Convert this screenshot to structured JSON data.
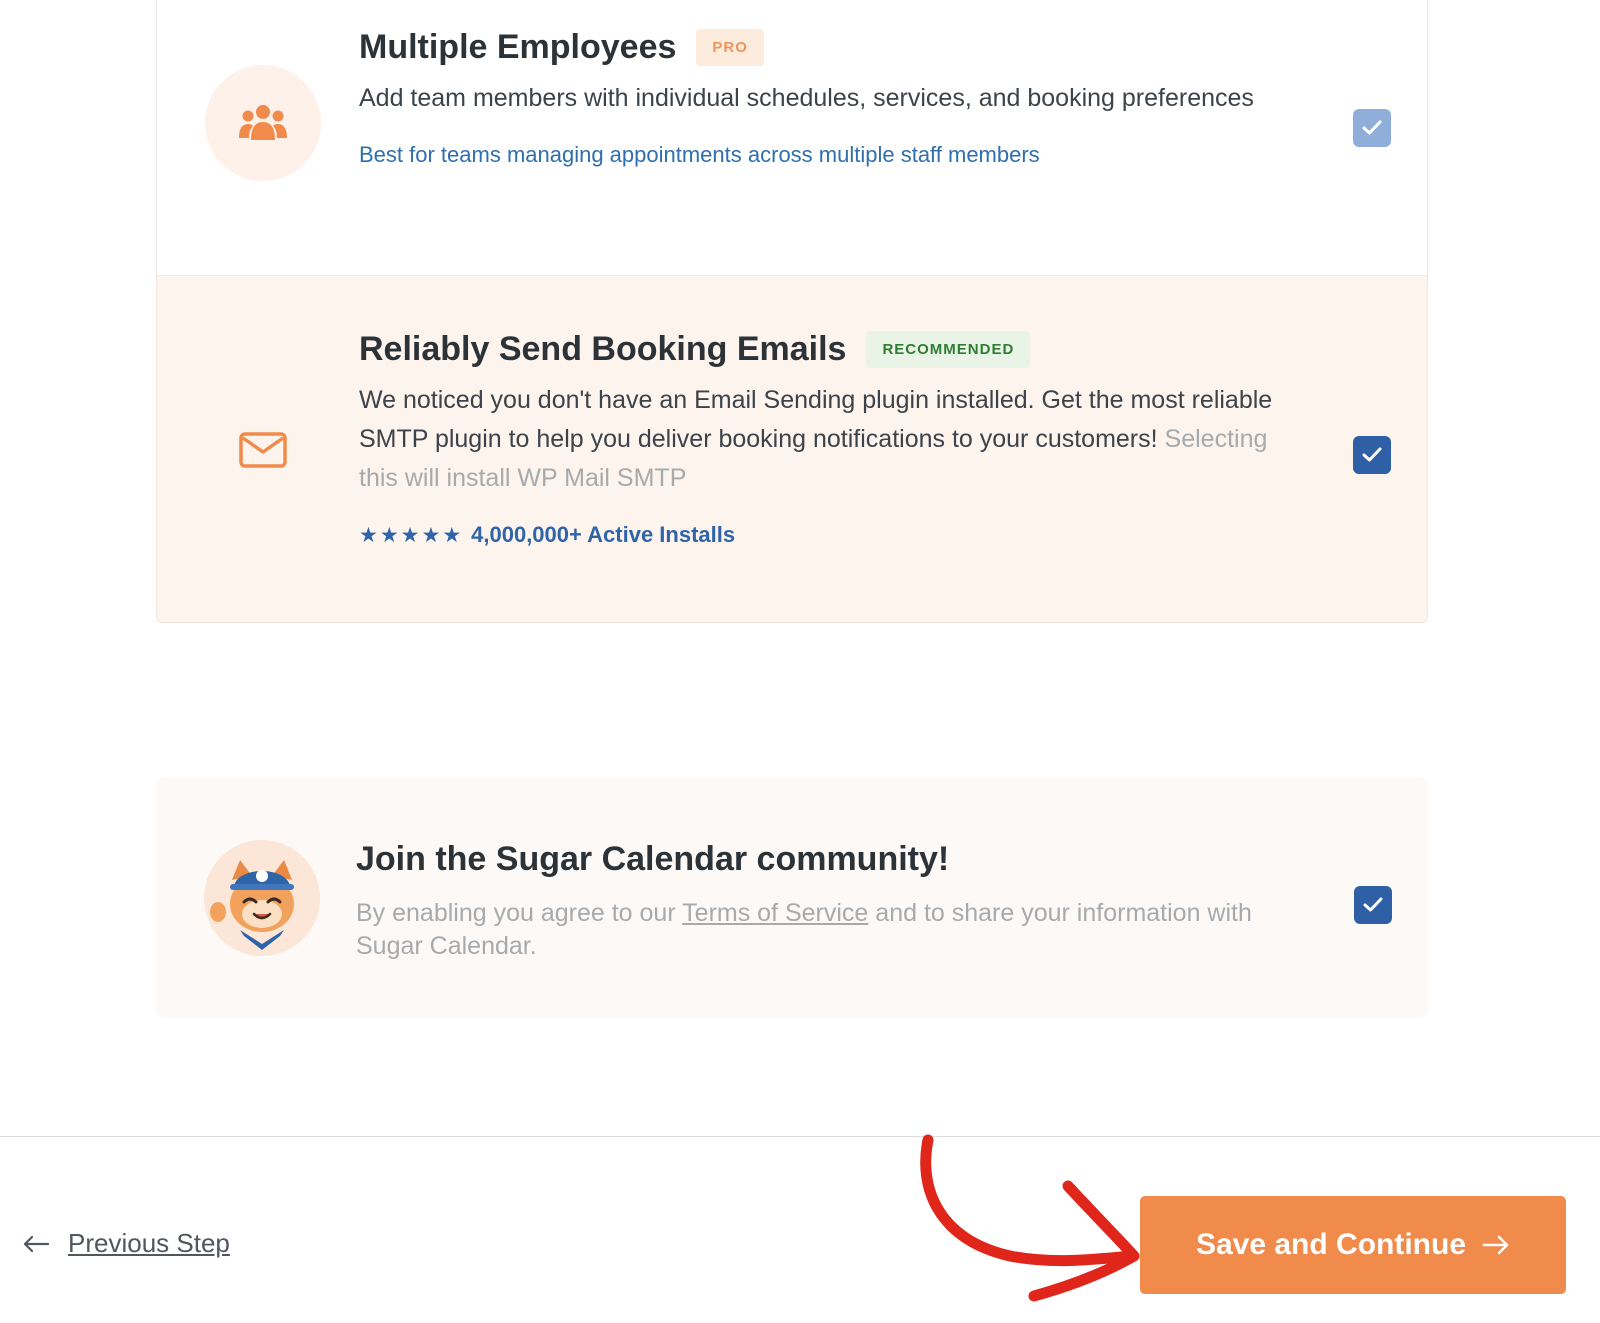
{
  "features": [
    {
      "title": "Multiple Employees",
      "badge": "PRO",
      "description": "Add team members with individual schedules, services, and booking preferences",
      "note": "Best for teams managing appointments across multiple staff members",
      "icon": "team-icon",
      "checked": true
    },
    {
      "title": "Reliably Send Booking Emails",
      "badge": "RECOMMENDED",
      "description": "We noticed you don't have an Email Sending plugin installed. Get the most reliable SMTP plugin to help you deliver booking notifications to your customers!",
      "description_muted": "Selecting this will install WP Mail SMTP",
      "stars": 5,
      "installs": "4,000,000+ Active Installs",
      "icon": "envelope-icon",
      "checked": true
    }
  ],
  "community": {
    "title": "Join the Sugar Calendar community!",
    "desc_prefix": "By enabling you agree to our",
    "tos_link": "Terms of Service",
    "desc_suffix": "and to share your information with Sugar Calendar.",
    "icon": "mascot-icon",
    "checked": true
  },
  "footer": {
    "previous_label": "Previous Step",
    "save_label": "Save and Continue"
  },
  "colors": {
    "accent": "#f08b4c",
    "checkbox_dark": "#2f5fa5",
    "checkbox_light": "#8fafda",
    "link_blue": "#2f6faf",
    "annotation_red": "#e0261b"
  }
}
